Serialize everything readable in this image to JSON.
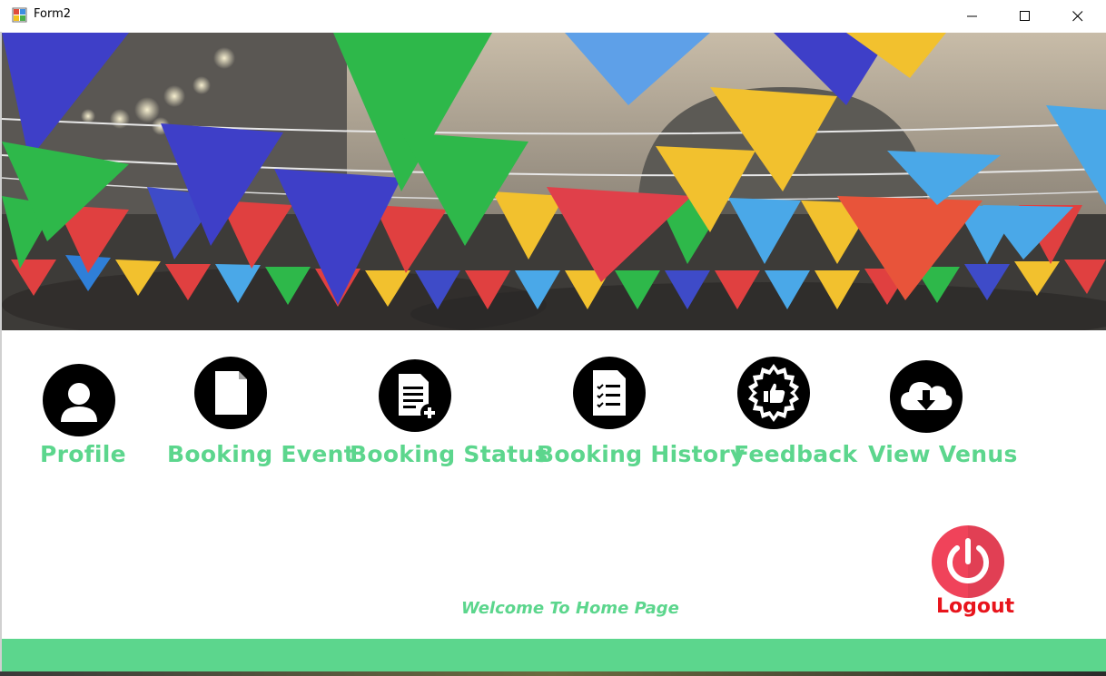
{
  "window": {
    "title": "Form2"
  },
  "menu": {
    "items": [
      {
        "label": "Profile",
        "icon": "user-icon"
      },
      {
        "label": "Booking Event",
        "icon": "document-icon"
      },
      {
        "label": "Booking Status",
        "icon": "document-add-icon"
      },
      {
        "label": "Booking History",
        "icon": "checklist-icon"
      },
      {
        "label": "Feedback",
        "icon": "thumbs-up-badge-icon"
      },
      {
        "label": "View Venus",
        "icon": "cloud-download-icon"
      }
    ]
  },
  "welcome_text": "Welcome To Home Page",
  "logout": {
    "label": "Logout",
    "icon": "power-icon"
  },
  "colors": {
    "accent": "#5cd68d",
    "logout": "#f0435a",
    "logout_text": "#e8141c"
  }
}
